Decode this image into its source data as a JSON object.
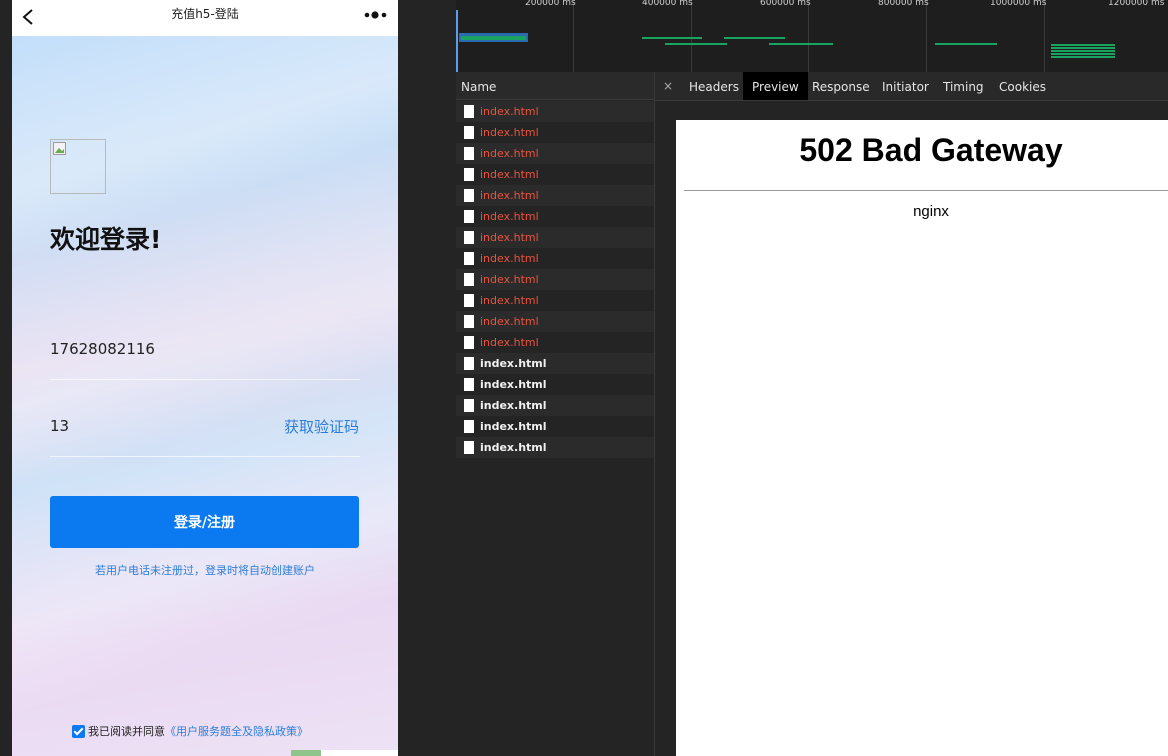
{
  "phone": {
    "nav_title": "充值h5-登陆",
    "welcome": "欢迎登录!",
    "phone_number": "17628082116",
    "code_value": "13",
    "get_code_label": "获取验证码",
    "login_label": "登录/注册",
    "hint": "若用户电话未注册过，登录时将自动创建账户",
    "agree_prefix": "我已阅读并同意",
    "agree_link": "《用户服务题全及隐私政策》",
    "agree_checked": true
  },
  "timeline": {
    "ticks": [
      "200000 ms",
      "400000 ms",
      "600000 ms",
      "800000 ms",
      "1000000 ms",
      "1200000 ms"
    ]
  },
  "network": {
    "name_header": "Name",
    "rows": [
      {
        "name": "index.html",
        "status": "error"
      },
      {
        "name": "index.html",
        "status": "error"
      },
      {
        "name": "index.html",
        "status": "error"
      },
      {
        "name": "index.html",
        "status": "error"
      },
      {
        "name": "index.html",
        "status": "error"
      },
      {
        "name": "index.html",
        "status": "error"
      },
      {
        "name": "index.html",
        "status": "error"
      },
      {
        "name": "index.html",
        "status": "error"
      },
      {
        "name": "index.html",
        "status": "error"
      },
      {
        "name": "index.html",
        "status": "error"
      },
      {
        "name": "index.html",
        "status": "error"
      },
      {
        "name": "index.html",
        "status": "error"
      },
      {
        "name": "index.html",
        "status": "ok"
      },
      {
        "name": "index.html",
        "status": "ok"
      },
      {
        "name": "index.html",
        "status": "ok"
      },
      {
        "name": "index.html",
        "status": "ok"
      },
      {
        "name": "index.html",
        "status": "ok"
      }
    ]
  },
  "detail": {
    "close": "×",
    "tabs": [
      "Headers",
      "Preview",
      "Response",
      "Initiator",
      "Timing",
      "Cookies"
    ],
    "active_tab": "Preview"
  },
  "preview": {
    "title": "502 Bad Gateway",
    "footer": "nginx"
  },
  "colors": {
    "accent": "#0b79ef",
    "link": "#2d7ed6",
    "error_row": "#e8533f",
    "timeline_bar": "#1aa260"
  }
}
